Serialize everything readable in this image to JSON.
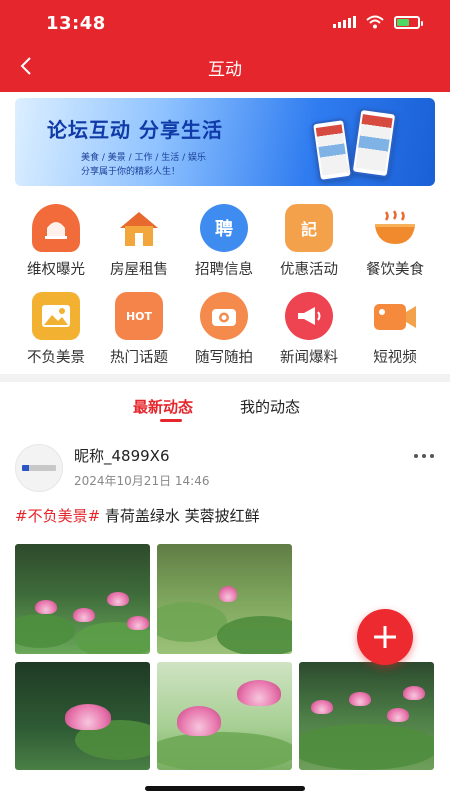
{
  "status_bar": {
    "time": "13:48"
  },
  "header": {
    "title": "互动"
  },
  "banner": {
    "title": "论坛互动  分享生活",
    "tags": "美食 / 美景 / 工作 / 生活 / 娱乐",
    "subtitle": "分享属于你的精彩人生！"
  },
  "features": [
    {
      "label": "维权曝光",
      "icon": "megaphone-alarm-icon",
      "color": "#f26b3a"
    },
    {
      "label": "房屋租售",
      "icon": "house-icon",
      "color": "#f0a03c"
    },
    {
      "label": "招聘信息",
      "icon": "hire-icon",
      "glyph": "聘",
      "color": "#3f8cf0"
    },
    {
      "label": "优惠活动",
      "icon": "notebook-icon",
      "glyph": "記",
      "color": "#f3a14a"
    },
    {
      "label": "餐饮美食",
      "icon": "bowl-icon",
      "color": "#f08a2c"
    },
    {
      "label": "不负美景",
      "icon": "landscape-photo-icon",
      "color": "#f2b130"
    },
    {
      "label": "热门话题",
      "icon": "hot-flame-icon",
      "glyph": "HOT",
      "color": "#f5844a"
    },
    {
      "label": "随写随拍",
      "icon": "camera-icon",
      "color": "#f48a4b"
    },
    {
      "label": "新闻爆料",
      "icon": "loudspeaker-icon",
      "color": "#ee4451"
    },
    {
      "label": "短视频",
      "icon": "video-camera-icon",
      "color": "#f58a3c"
    }
  ],
  "tabs": [
    {
      "label": "最新动态",
      "active": true
    },
    {
      "label": "我的动态",
      "active": false
    }
  ],
  "post": {
    "nickname": "昵称_4899X6",
    "time": "2024年10月21日 14:46",
    "hashtag": "#不负美景#",
    "text": " 青荷盖绿水 芙蓉披红鲜",
    "photos": [
      {
        "subject": "lotus-pond-pink-flowers"
      },
      {
        "subject": "lotus-leaves-bud"
      },
      {
        "subject": "pink-lotus-bloom"
      },
      {
        "subject": "pink-lotus-close-up"
      },
      {
        "subject": "lotus-pond-flowers"
      }
    ]
  },
  "fab": {
    "icon": "plus-icon"
  }
}
